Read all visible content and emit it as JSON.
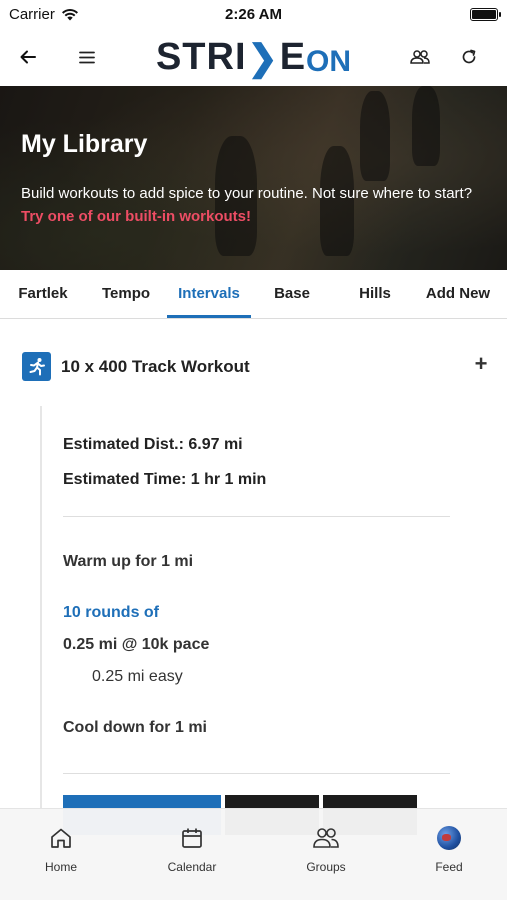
{
  "status_bar": {
    "carrier": "Carrier",
    "time": "2:26 AM"
  },
  "header": {
    "logo_text_left": "STRI",
    "logo_chevron": "❯",
    "logo_text_mid": "E",
    "logo_text_on": "ON"
  },
  "hero": {
    "title": "My Library",
    "text": "Build workouts to add spice to your routine. Not sure where to start?",
    "link": "Try one of our built-in workouts!"
  },
  "tabs": [
    {
      "label": "Fartlek"
    },
    {
      "label": "Tempo"
    },
    {
      "label": "Intervals"
    },
    {
      "label": "Base"
    },
    {
      "label": "Hills"
    },
    {
      "label": "Add New"
    }
  ],
  "active_tab": "Intervals",
  "workout": {
    "title": "10 x 400 Track Workout",
    "plus": "+",
    "est_dist": "Estimated Dist.: 6.97 mi",
    "est_time": "Estimated Time: 1 hr 1 min",
    "warmup": "Warm up for 1 mi",
    "rounds": "10 rounds of",
    "interval": "0.25 mi @ 10k pace",
    "recovery": "0.25 mi easy",
    "cooldown": "Cool down for 1 mi"
  },
  "bottom_nav": [
    {
      "label": "Home",
      "icon": "home-icon"
    },
    {
      "label": "Calendar",
      "icon": "calendar-icon"
    },
    {
      "label": "Groups",
      "icon": "groups-icon"
    },
    {
      "label": "Feed",
      "icon": "globe-icon"
    }
  ],
  "colors": {
    "accent": "#1e6fb8",
    "link": "#ec4d64",
    "logo_dark": "#1d2430"
  }
}
